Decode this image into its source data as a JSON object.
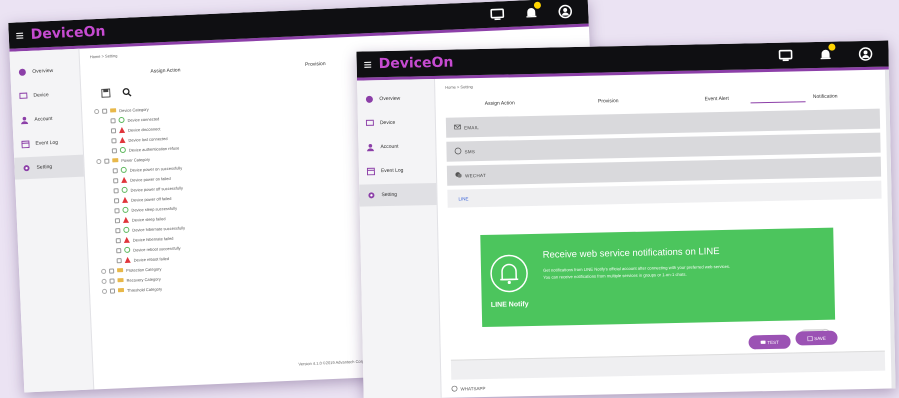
{
  "app": {
    "brand": "DeviceOn",
    "menu_glyph": "≡",
    "accent": "#8c3fa8",
    "topbar_icons": [
      "monitor-icon",
      "bell-icon",
      "user-icon"
    ]
  },
  "sidebar": {
    "items": [
      {
        "label": "Overview",
        "icon": "overview-icon"
      },
      {
        "label": "Device",
        "icon": "device-icon"
      },
      {
        "label": "Account",
        "icon": "account-icon"
      },
      {
        "label": "Event Log",
        "icon": "event-log-icon"
      },
      {
        "label": "Setting",
        "icon": "setting-icon"
      }
    ]
  },
  "back": {
    "breadcrumb": "Home > Setting",
    "tabs": [
      "Assign Action",
      "Provision"
    ],
    "tree": {
      "device_category": "Device Category",
      "device_items": [
        {
          "label": "Device connected",
          "status": "ok"
        },
        {
          "label": "Device disconnect",
          "status": "warn"
        },
        {
          "label": "Device lost connected",
          "status": "warn"
        },
        {
          "label": "Device authentication refuse",
          "status": "ok"
        }
      ],
      "power_category": "Power Category",
      "power_items": [
        {
          "label": "Device power on successfully",
          "status": "ok"
        },
        {
          "label": "Device power on failed",
          "status": "warn"
        },
        {
          "label": "Device power off successfully",
          "status": "ok"
        },
        {
          "label": "Device power off failed",
          "status": "warn"
        },
        {
          "label": "Device sleep successfully",
          "status": "ok"
        },
        {
          "label": "Device sleep failed",
          "status": "warn"
        },
        {
          "label": "Device hibernate successfully",
          "status": "ok"
        },
        {
          "label": "Device hibernate failed",
          "status": "warn"
        },
        {
          "label": "Device reboot successfully",
          "status": "ok"
        },
        {
          "label": "Device reboot failed",
          "status": "warn"
        }
      ],
      "other_categories": [
        "Protection Category",
        "Recovery Category",
        "Threshold Category"
      ]
    },
    "footer": "Version 4.1.0 ©2019 Advantech Corp. All rights reserved"
  },
  "front": {
    "breadcrumb": "Home > Setting",
    "tabs": [
      "Assign Action",
      "Provision",
      "Event Alert",
      "Notification"
    ],
    "sections": [
      {
        "label": "EMAIL",
        "icon": "email-icon"
      },
      {
        "label": "SMS",
        "icon": "sms-icon"
      },
      {
        "label": "WECHAT",
        "icon": "wechat-icon"
      }
    ],
    "line": {
      "label": "LINE",
      "logo_text": "LINE Notify",
      "heading": "Receive web service notifications on LINE",
      "desc1": "Get notifications from LINE Notify's official account after connecting with your preferred web services.",
      "desc2": "You can receive notifications from multiple services in groups or 1-on-1 chats.",
      "color": "#4cc55d"
    },
    "buttons": {
      "test": "TEST",
      "save": "SAVE"
    },
    "whatsapp": "WHATSAPP"
  }
}
